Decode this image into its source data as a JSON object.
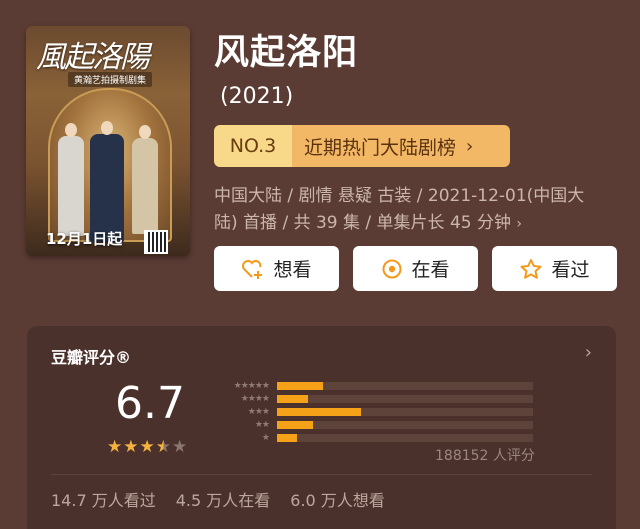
{
  "poster": {
    "title_art": "風起洛陽",
    "subtitle": "黄瀚艺拍摄制剧集",
    "date_text": "12月1日起"
  },
  "show": {
    "title": "风起洛阳",
    "year": "(2021)"
  },
  "rank": {
    "number": "NO.3",
    "label": "近期热门大陆剧榜",
    "chevron": "›"
  },
  "meta": {
    "line1": "中国大陆 / 剧情 悬疑 古装 / 2021-12-01(中国大",
    "line2": "陆) 首播 / 共 39 集 / 单集片长 45 分钟",
    "chevron": "›"
  },
  "actions": [
    {
      "label": "想看",
      "icon": "heart-plus-icon"
    },
    {
      "label": "在看",
      "icon": "target-circle-icon"
    },
    {
      "label": "看过",
      "icon": "star-outline-icon"
    }
  ],
  "rating": {
    "title": "豆瓣评分®",
    "chevron": "›",
    "score": "6.7",
    "stars_value": 3.5,
    "star_glyph": "★",
    "distribution": [
      {
        "stars": 5,
        "fraction": 0.18
      },
      {
        "stars": 4,
        "fraction": 0.12
      },
      {
        "stars": 3,
        "fraction": 0.33
      },
      {
        "stars": 2,
        "fraction": 0.14
      },
      {
        "stars": 1,
        "fraction": 0.08
      }
    ],
    "votes": "188152 人评分",
    "watched": "14.7 万人看过",
    "watching": "4.5 万人在看",
    "want": "6.0 万人想看"
  },
  "colors": {
    "background": "#5b3c34",
    "card": "#4a312b",
    "rank_left": "#f8d98a",
    "rank_right": "#f2b866",
    "star": "#f6b23f",
    "bar": "#f6a219",
    "action_icon": "#f39a1c"
  }
}
